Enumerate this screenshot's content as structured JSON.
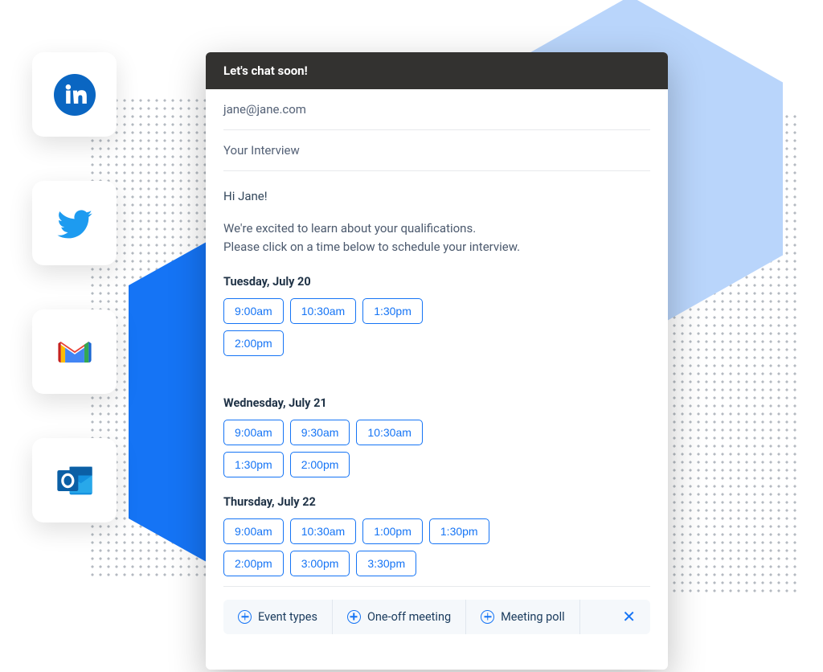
{
  "email": {
    "title": "Let's chat soon!",
    "to": "jane@jane.com",
    "subject": "Your Interview",
    "greeting": "Hi Jane!",
    "body_line1": "We're excited to learn about your qualifications.",
    "body_line2": "Please click on a time below to schedule your interview.",
    "days": [
      {
        "label": "Tuesday, July 20",
        "slots": [
          "9:00am",
          "10:30am",
          "1:30pm",
          "2:00pm"
        ]
      },
      {
        "label": "Wednesday, July 21",
        "slots": [
          "9:00am",
          "9:30am",
          "10:30am",
          "1:30pm",
          "2:00pm"
        ]
      },
      {
        "label": "Thursday, July 22",
        "slots": [
          "9:00am",
          "10:30am",
          "1:00pm",
          "1:30pm",
          "2:00pm",
          "3:00pm",
          "3:30pm"
        ]
      }
    ]
  },
  "actions": {
    "event_types": "Event types",
    "one_off": "One-off meeting",
    "poll": "Meeting poll"
  },
  "social": [
    "linkedin",
    "twitter",
    "gmail",
    "outlook"
  ]
}
